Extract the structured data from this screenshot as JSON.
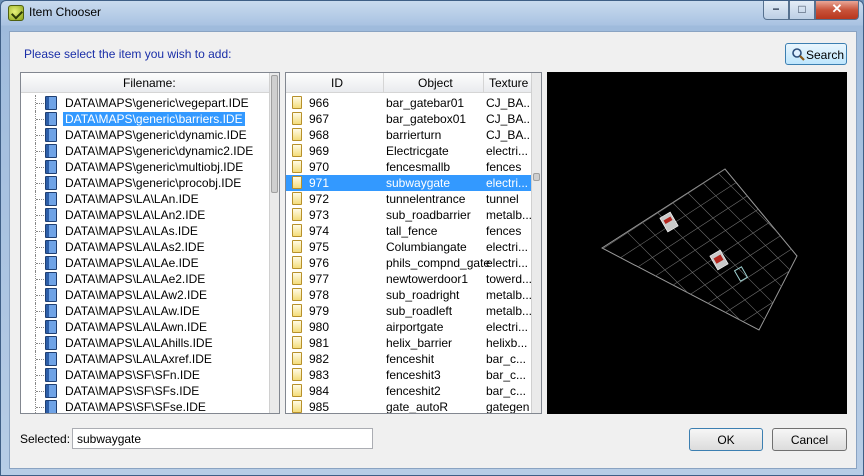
{
  "window": {
    "title": "Item Chooser",
    "caption": {
      "minimize": "−",
      "maximize": "□",
      "close": "✕"
    }
  },
  "prompt": "Please select the item you wish to add:",
  "search_button": {
    "label": "Search",
    "icon": "magnifier-icon"
  },
  "file_list": {
    "header": "Filename:",
    "items": [
      "DATA\\MAPS\\generic\\vegepart.IDE",
      "DATA\\MAPS\\generic\\barriers.IDE",
      "DATA\\MAPS\\generic\\dynamic.IDE",
      "DATA\\MAPS\\generic\\dynamic2.IDE",
      "DATA\\MAPS\\generic\\multiobj.IDE",
      "DATA\\MAPS\\generic\\procobj.IDE",
      "DATA\\MAPS\\LA\\LAn.IDE",
      "DATA\\MAPS\\LA\\LAn2.IDE",
      "DATA\\MAPS\\LA\\LAs.IDE",
      "DATA\\MAPS\\LA\\LAs2.IDE",
      "DATA\\MAPS\\LA\\LAe.IDE",
      "DATA\\MAPS\\LA\\LAe2.IDE",
      "DATA\\MAPS\\LA\\LAw2.IDE",
      "DATA\\MAPS\\LA\\LAw.IDE",
      "DATA\\MAPS\\LA\\LAwn.IDE",
      "DATA\\MAPS\\LA\\LAhills.IDE",
      "DATA\\MAPS\\LA\\LAxref.IDE",
      "DATA\\MAPS\\SF\\SFn.IDE",
      "DATA\\MAPS\\SF\\SFs.IDE",
      "DATA\\MAPS\\SF\\SFse.IDE"
    ],
    "selected_index": 1
  },
  "object_list": {
    "headers": {
      "id": "ID",
      "object": "Object",
      "texture": "Texture"
    },
    "rows": [
      {
        "id": "966",
        "object": "bar_gatebar01",
        "texture": "CJ_BA..."
      },
      {
        "id": "967",
        "object": "bar_gatebox01",
        "texture": "CJ_BA..."
      },
      {
        "id": "968",
        "object": "barrierturn",
        "texture": "CJ_BA..."
      },
      {
        "id": "969",
        "object": "Electricgate",
        "texture": "electri..."
      },
      {
        "id": "970",
        "object": "fencesmallb",
        "texture": "fences"
      },
      {
        "id": "971",
        "object": "subwaygate",
        "texture": "electri..."
      },
      {
        "id": "972",
        "object": "tunnelentrance",
        "texture": "tunnel"
      },
      {
        "id": "973",
        "object": "sub_roadbarrier",
        "texture": "metalb..."
      },
      {
        "id": "974",
        "object": "tall_fence",
        "texture": "fences"
      },
      {
        "id": "975",
        "object": "Columbiangate",
        "texture": "electri..."
      },
      {
        "id": "976",
        "object": "phils_compnd_gate",
        "texture": "electri..."
      },
      {
        "id": "977",
        "object": "newtowerdoor1",
        "texture": "towerd..."
      },
      {
        "id": "978",
        "object": "sub_roadright",
        "texture": "metalb..."
      },
      {
        "id": "979",
        "object": "sub_roadleft",
        "texture": "metalb..."
      },
      {
        "id": "980",
        "object": "airportgate",
        "texture": "electri..."
      },
      {
        "id": "981",
        "object": "helix_barrier",
        "texture": "helixb..."
      },
      {
        "id": "982",
        "object": "fenceshit",
        "texture": "bar_c..."
      },
      {
        "id": "983",
        "object": "fenceshit3",
        "texture": "bar_c..."
      },
      {
        "id": "984",
        "object": "fenceshit2",
        "texture": "bar_c..."
      },
      {
        "id": "985",
        "object": "gate_autoR",
        "texture": "gategen"
      }
    ],
    "selected_index": 5
  },
  "selected": {
    "label": "Selected:",
    "value": "subwaygate"
  },
  "ok_button": "OK",
  "cancel_button": "Cancel",
  "colors": {
    "selection": "#3399ff",
    "prompt_text": "#1a2fa8",
    "preview_bg": "#000000"
  }
}
